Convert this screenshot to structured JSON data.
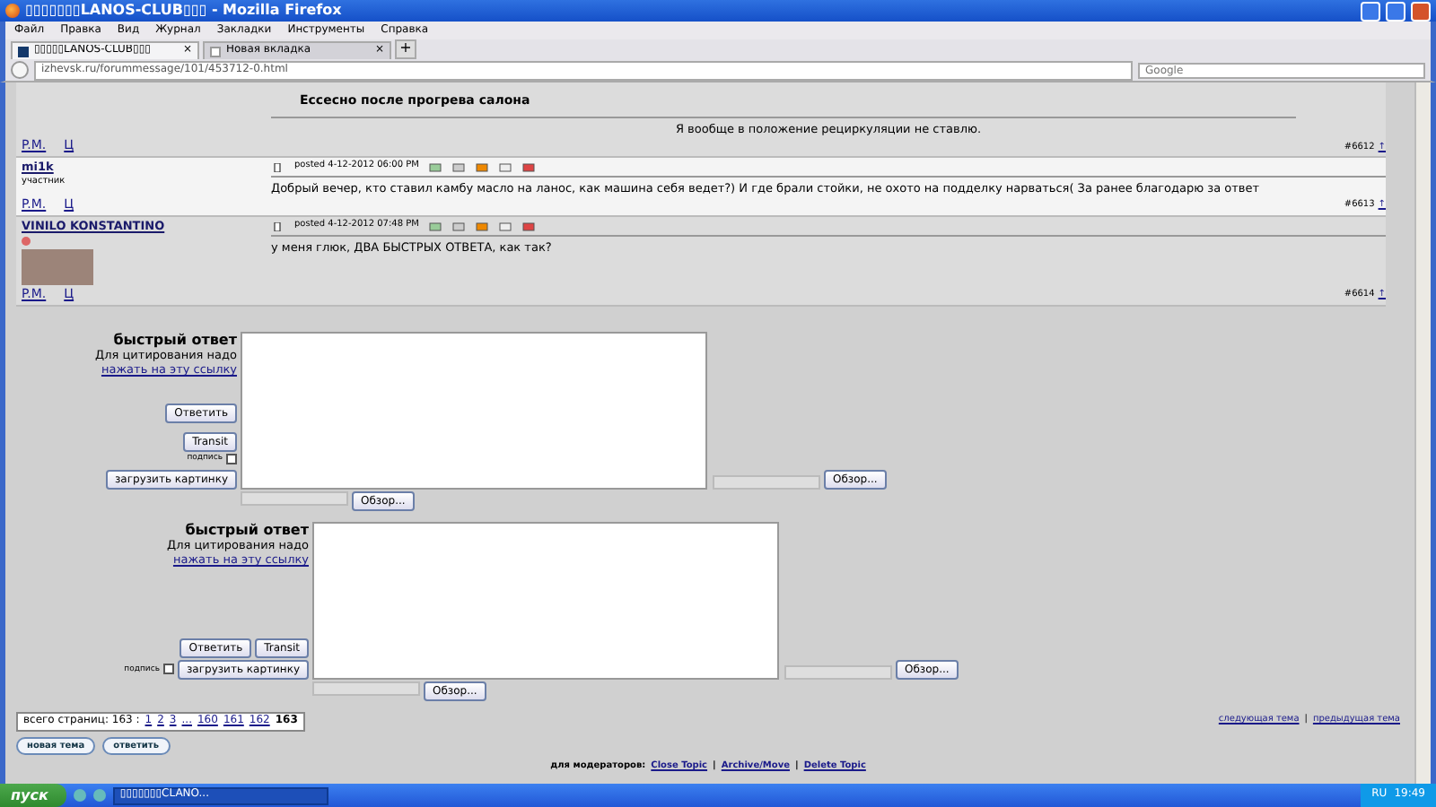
{
  "window": {
    "title": "▯▯▯▯▯▯▯LANOS-CLUB▯▯▯ - Mozilla Firefox"
  },
  "menu": [
    "Файл",
    "Правка",
    "Вид",
    "Журнал",
    "Закладки",
    "Инструменты",
    "Справка"
  ],
  "tabs": [
    {
      "label": "▯▯▯▯▯LANOS-CLUB▯▯▯",
      "selected": true,
      "close": "×"
    },
    {
      "label": "Новая вкладка",
      "selected": false,
      "close": "×"
    }
  ],
  "new_tab": "+",
  "address": {
    "url": "izhevsk.ru/forummessage/101/453712-0.html"
  },
  "search": {
    "placeholder": "Google"
  },
  "posts": [
    {
      "quote": "Ессесно после прогрева салона",
      "text": "Я вообще в положение рециркуляции не ставлю.",
      "pm": "P.M.",
      "c": "Ц",
      "number": "#6612",
      "up": "↑",
      "highlighted": false
    },
    {
      "author": "mi1k",
      "rank": "участник",
      "posted": "posted 4-12-2012 06:00 PM",
      "text": "Добрый вечер, кто ставил камбу масло на ланос, как машина себя ведет?) И где брали стойки, не охото на подделку нарваться( За ранее благодарю за ответ",
      "pm": "P.M.",
      "c": "Ц",
      "number": "#6613",
      "up": "↑",
      "highlighted": true
    },
    {
      "author": "VINILO KONSTANTINO",
      "avatar": true,
      "posted": "posted 4-12-2012 07:48 PM",
      "text": "у меня глюк, ДВА БЫСТРЫХ ОТВЕТА, как так?",
      "pm": "P.M.",
      "c": "Ц",
      "number": "#6614",
      "up": "↑",
      "highlighted": false
    }
  ],
  "forms": [
    {
      "kind": "stacked",
      "title": "быстрый ответ",
      "hint": "Для цитирования надо",
      "link": "нажать на эту ссылку",
      "reply": "Ответить",
      "translit": "Transit",
      "signature": {
        "label": "подпись",
        "checked": false
      },
      "upload": "загрузить картинку",
      "browse": [
        "Обзор...",
        "Обзор..."
      ]
    },
    {
      "kind": "inline",
      "title": "быстрый ответ",
      "hint": "Для цитирования надо",
      "link": "нажать на эту ссылку",
      "reply": "Ответить",
      "translit": "Transit",
      "signature": {
        "label": "подпись",
        "checked": false
      },
      "upload": "загрузить картинку",
      "browse": [
        "Обзор...",
        "Обзор..."
      ]
    }
  ],
  "pager": {
    "label": "всего страниц: 163 :",
    "pages": [
      {
        "label": "1",
        "selected": false
      },
      {
        "label": "2",
        "selected": false
      },
      {
        "label": "3",
        "selected": false
      },
      {
        "label": "...",
        "selected": false
      },
      {
        "label": "160",
        "selected": false
      },
      {
        "label": "161",
        "selected": false
      },
      {
        "label": "162",
        "selected": false
      },
      {
        "label": "163",
        "selected": true
      }
    ]
  },
  "topic_nav": {
    "links": [
      "следующая тема",
      "предыдущая тема"
    ],
    "separator": "|"
  },
  "topic_buttons": [
    "новая тема",
    "ответить"
  ],
  "moderators": {
    "label": "для модераторов:",
    "links": [
      "Close Topic",
      "Archive/Move",
      "Delete Topic"
    ],
    "separator": "|"
  },
  "taskbar": {
    "start": "пуск",
    "task": "▯▯▯▯▯▯▯CLANO...",
    "lang": "RU",
    "clock": "19:49"
  }
}
